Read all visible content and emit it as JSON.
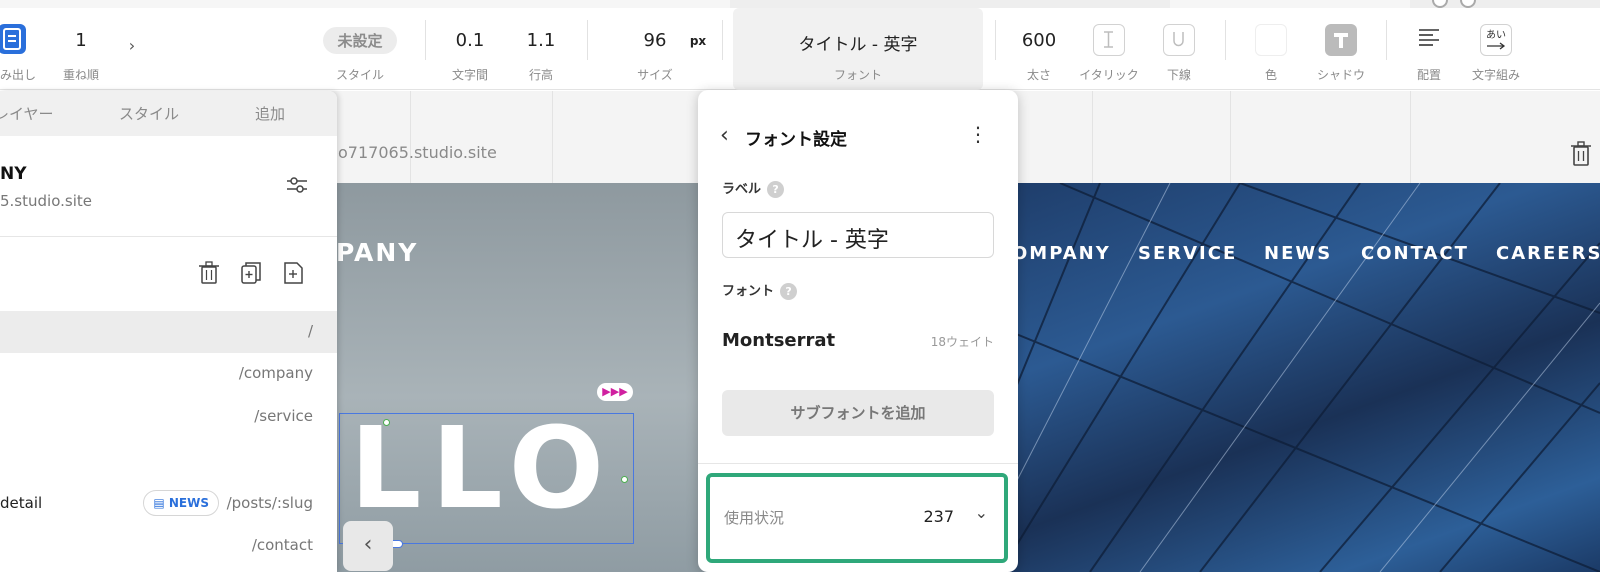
{
  "toolbar": {
    "heading_label": "み出し",
    "order": {
      "value": "1",
      "label": "重ね順"
    },
    "style": {
      "value": "未設定",
      "label": "スタイル"
    },
    "letter_spacing": {
      "value": "0.1",
      "label": "文字間"
    },
    "line_height": {
      "value": "1.1",
      "label": "行高"
    },
    "size": {
      "value": "96",
      "unit": "px",
      "label": "サイズ"
    },
    "font": {
      "value": "タイトル - 英字",
      "label": "フォント"
    },
    "weight": {
      "value": "600",
      "label": "太さ"
    },
    "italic": {
      "label": "イタリック"
    },
    "underline": {
      "label": "下線"
    },
    "color": {
      "label": "色"
    },
    "shadow": {
      "label": "シャドウ"
    },
    "align": {
      "label": "配置"
    },
    "typesetting": {
      "label": "文字組み",
      "icon_text": "あい"
    }
  },
  "left_panel": {
    "tabs": [
      "レイヤー",
      "スタイル",
      "追加"
    ],
    "site_title": "NY",
    "site_url": "5.studio.site",
    "pages": [
      {
        "name": "",
        "path": "/"
      },
      {
        "name": "",
        "path": "/company"
      },
      {
        "name": "",
        "path": "/service"
      },
      {
        "name": "detail",
        "badge": "NEWS",
        "path": "/posts/:slug"
      },
      {
        "name": "",
        "path": "/contact"
      }
    ]
  },
  "canvas": {
    "url_text": "o717065.studio.site",
    "logo_text": "PANY",
    "nav": [
      "OMPANY",
      "SERVICE",
      "NEWS",
      "CONTACT",
      "CAREERS"
    ],
    "hero_text": "LLO"
  },
  "font_popup": {
    "title": "フォント設定",
    "label_heading": "ラベル",
    "label_value": "タイトル - 英字",
    "font_heading": "フォント",
    "font_name": "Montserrat",
    "font_weights": "18ウェイト",
    "add_subfont": "サブフォントを追加",
    "usage_label": "使用状況",
    "usage_count": "237"
  },
  "colors": {
    "accent_blue": "#2a6fdb",
    "usage_highlight": "#2fa87a",
    "anim_badge": "#d020a0"
  }
}
